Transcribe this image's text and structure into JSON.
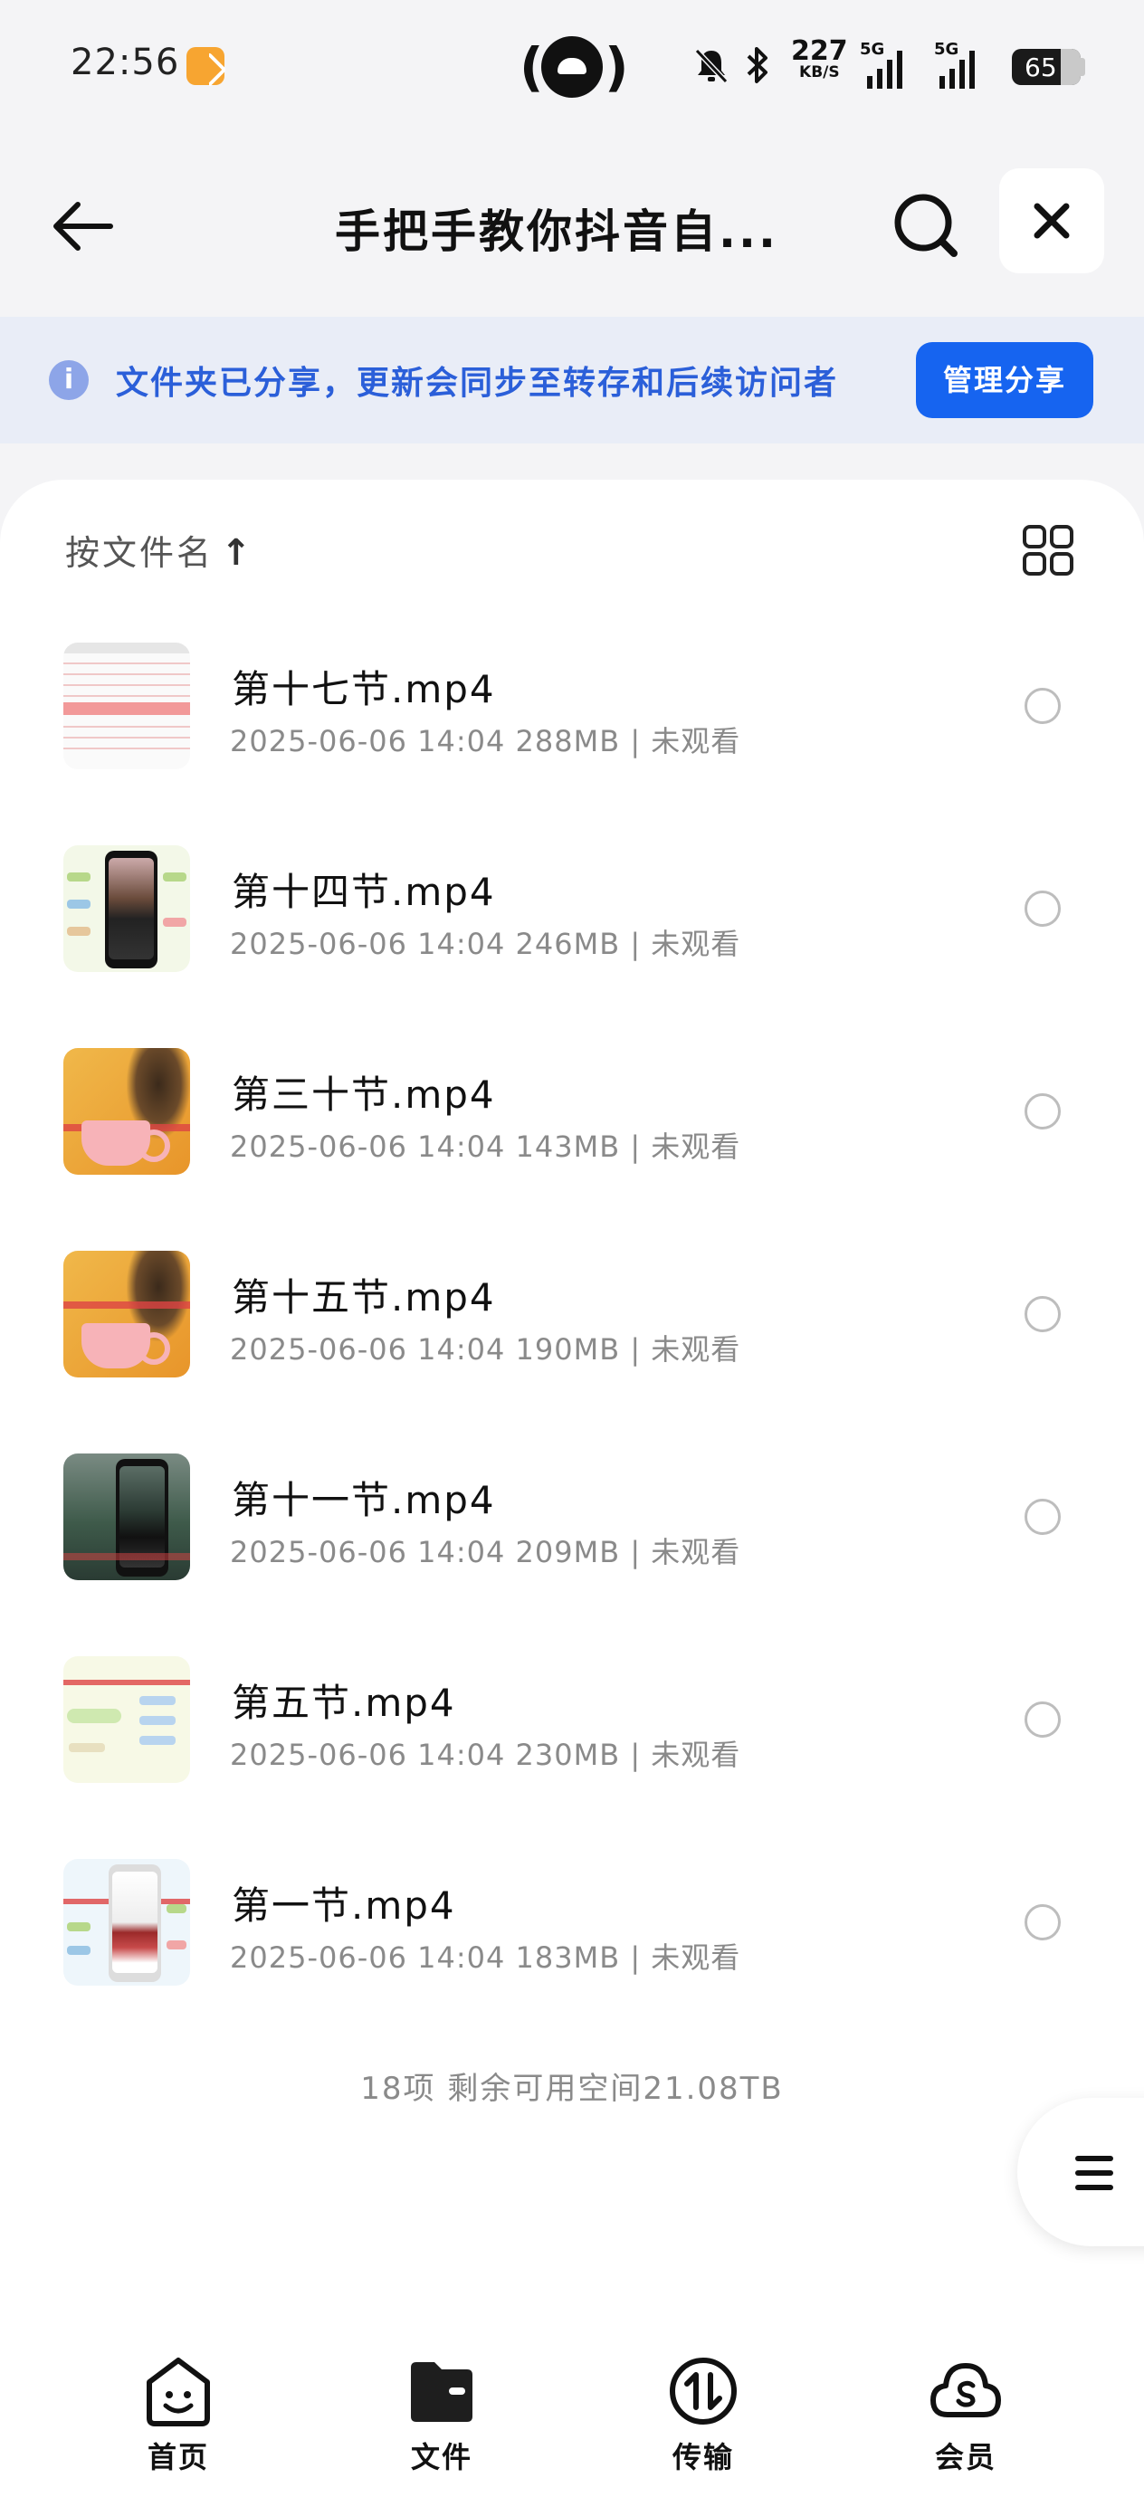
{
  "status_bar": {
    "time": "22:56",
    "net_speed_value": "227",
    "net_speed_unit": "KB/S",
    "signal1_label": "5G",
    "signal2_label": "5G",
    "battery": "65"
  },
  "header": {
    "title": "手把手教你抖音自..."
  },
  "share_banner": {
    "text": "文件夹已分享，更新会同步至转存和后续访问者",
    "button_label": "管理分享"
  },
  "sort": {
    "label": "按文件名",
    "arrow": "↑"
  },
  "files": [
    {
      "name": "第十七节.mp4",
      "meta": "2025-06-06 14:04  288MB | 未观看",
      "thumb": "sheet"
    },
    {
      "name": "第十四节.mp4",
      "meta": "2025-06-06 14:04  246MB | 未观看",
      "thumb": "mind-phone"
    },
    {
      "name": "第三十节.mp4",
      "meta": "2025-06-06 14:04  143MB | 未观看",
      "thumb": "orange-dog"
    },
    {
      "name": "第十五节.mp4",
      "meta": "2025-06-06 14:04  190MB | 未观看",
      "thumb": "orange-dog"
    },
    {
      "name": "第十一节.mp4",
      "meta": "2025-06-06 14:04  209MB | 未观看",
      "thumb": "forest-phone"
    },
    {
      "name": "第五节.mp4",
      "meta": "2025-06-06 14:04  230MB | 未观看",
      "thumb": "mind"
    },
    {
      "name": "第一节.mp4",
      "meta": "2025-06-06 14:04  183MB | 未观看",
      "thumb": "mind-phone2"
    }
  ],
  "footer": {
    "stats": "18项 剩余可用空间21.08TB"
  },
  "bottom_nav": {
    "home": "首页",
    "files": "文件",
    "transfer": "传输",
    "vip": "会员"
  },
  "colors": {
    "accent": "#1664f0",
    "banner_bg": "#e9edf7",
    "banner_text": "#2b5fd9"
  }
}
